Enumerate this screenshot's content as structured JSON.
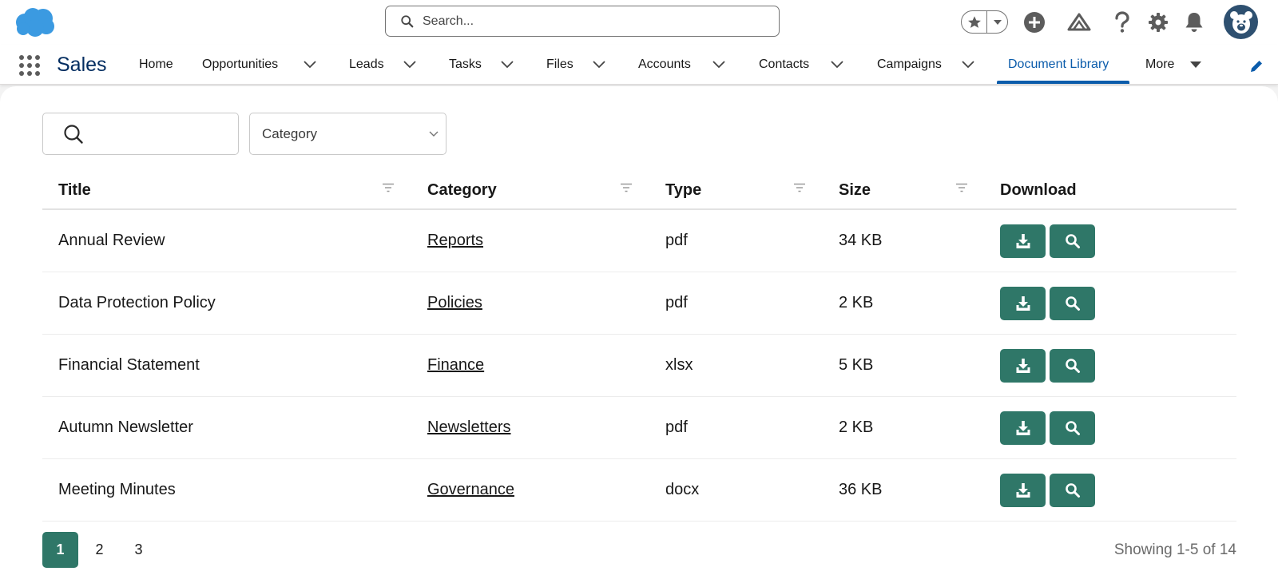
{
  "header": {
    "search_placeholder": "Search..."
  },
  "nav": {
    "app_name": "Sales",
    "items": [
      {
        "label": "Home"
      },
      {
        "label": "Opportunities"
      },
      {
        "label": "Leads"
      },
      {
        "label": "Tasks"
      },
      {
        "label": "Files"
      },
      {
        "label": "Accounts"
      },
      {
        "label": "Contacts"
      },
      {
        "label": "Campaigns"
      },
      {
        "label": "Document Library",
        "active": true
      },
      {
        "label": "More"
      }
    ]
  },
  "filters": {
    "category_label": "Category"
  },
  "table": {
    "columns": [
      "Title",
      "Category",
      "Type",
      "Size",
      "Download"
    ],
    "rows": [
      {
        "title": "Annual Review",
        "category": "Reports",
        "type": "pdf",
        "size": "34 KB"
      },
      {
        "title": "Data Protection Policy",
        "category": "Policies",
        "type": "pdf",
        "size": "2 KB"
      },
      {
        "title": "Financial Statement",
        "category": "Finance",
        "type": "xlsx",
        "size": "5 KB"
      },
      {
        "title": "Autumn Newsletter",
        "category": "Newsletters",
        "type": "pdf",
        "size": "2 KB"
      },
      {
        "title": "Meeting Minutes",
        "category": "Governance",
        "type": "docx",
        "size": "36 KB"
      }
    ]
  },
  "pagination": {
    "pages": [
      "1",
      "2",
      "3"
    ],
    "current": "1",
    "showing": "Showing 1-5 of 14"
  },
  "colors": {
    "accent": "#2f7768",
    "nav_active": "#0b5cab",
    "brand_cloud": "#3b9ae1",
    "app_name": "#032d60"
  },
  "icons": {
    "logo": "salesforce-cloud",
    "favorites": "star-icon",
    "add": "plus-circle-icon",
    "trailhead": "mountain-icon",
    "help": "question-icon",
    "setup": "gear-icon",
    "notifications": "bell-icon",
    "avatar": "bear-avatar",
    "row_download": "download-icon",
    "row_preview": "magnifier-icon"
  }
}
